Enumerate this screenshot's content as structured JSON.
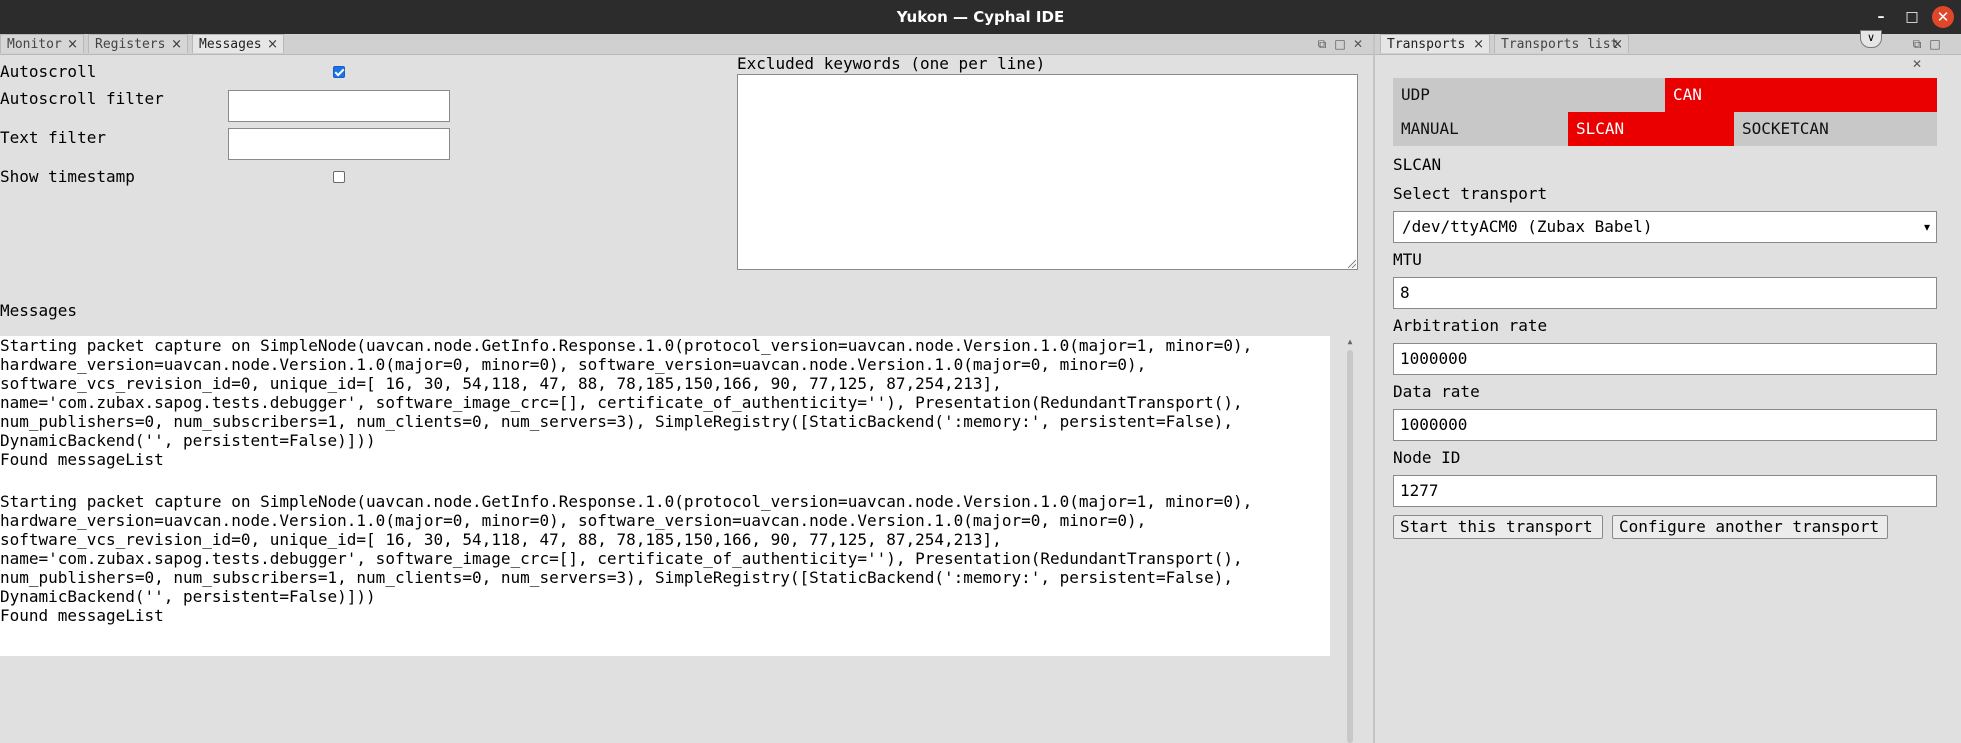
{
  "window": {
    "title": "Yukon — Cyphal IDE",
    "minimize": "–",
    "maximize": "□",
    "close": "✕"
  },
  "left_tabs": [
    {
      "label": "Monitor",
      "close": "×"
    },
    {
      "label": "Registers",
      "close": "×"
    },
    {
      "label": "Messages",
      "close": "×"
    }
  ],
  "right_tabs": [
    {
      "label": "Transports",
      "close": "×"
    },
    {
      "label": "Transports list",
      "close": "×"
    }
  ],
  "messages_panel": {
    "autoscroll_label": "Autoscroll",
    "autoscroll_checked": true,
    "autoscroll_filter_label": "Autoscroll filter",
    "autoscroll_filter_value": "",
    "text_filter_label": "Text filter",
    "text_filter_value": "",
    "show_timestamp_label": "Show timestamp",
    "show_timestamp_checked": false,
    "excluded_keywords_label": "Excluded keywords (one per line)",
    "excluded_keywords_value": "",
    "messages_label": "Messages",
    "log": [
      "Starting packet capture on SimpleNode(uavcan.node.GetInfo.Response.1.0(protocol_version=uavcan.node.Version.1.0(major=1, minor=0),\nhardware_version=uavcan.node.Version.1.0(major=0, minor=0), software_version=uavcan.node.Version.1.0(major=0, minor=0),\nsoftware_vcs_revision_id=0, unique_id=[ 16, 30, 54,118, 47, 88, 78,185,150,166, 90, 77,125, 87,254,213],\nname='com.zubax.sapog.tests.debugger', software_image_crc=[], certificate_of_authenticity=''), Presentation(RedundantTransport(),\nnum_publishers=0, num_subscribers=1, num_clients=0, num_servers=3), SimpleRegistry([StaticBackend(':memory:', persistent=False),\nDynamicBackend('', persistent=False)]))\nFound messageList",
      "Starting packet capture on SimpleNode(uavcan.node.GetInfo.Response.1.0(protocol_version=uavcan.node.Version.1.0(major=1, minor=0),\nhardware_version=uavcan.node.Version.1.0(major=0, minor=0), software_version=uavcan.node.Version.1.0(major=0, minor=0),\nsoftware_vcs_revision_id=0, unique_id=[ 16, 30, 54,118, 47, 88, 78,185,150,166, 90, 77,125, 87,254,213],\nname='com.zubax.sapog.tests.debugger', software_image_crc=[], certificate_of_authenticity=''), Presentation(RedundantTransport(),\nnum_publishers=0, num_subscribers=1, num_clients=0, num_servers=3), SimpleRegistry([StaticBackend(':memory:', persistent=False),\nDynamicBackend('', persistent=False)]))\nFound messageList"
    ]
  },
  "transports_panel": {
    "protocol_tabs": [
      {
        "label": "UDP",
        "active": false
      },
      {
        "label": "CAN",
        "active": true
      }
    ],
    "can_tabs": [
      {
        "label": "MANUAL",
        "active": false
      },
      {
        "label": "SLCAN",
        "active": true
      },
      {
        "label": "SOCKETCAN",
        "active": false
      }
    ],
    "section_title": "SLCAN",
    "select_transport_label": "Select transport",
    "select_transport_value": "/dev/ttyACM0 (Zubax Babel)",
    "mtu_label": "MTU",
    "mtu_value": "8",
    "arbitration_rate_label": "Arbitration rate",
    "arbitration_rate_value": "1000000",
    "data_rate_label": "Data rate",
    "data_rate_value": "1000000",
    "node_id_label": "Node ID",
    "node_id_value": "1277",
    "start_button": "Start this transport",
    "configure_button": "Configure another transport"
  },
  "colors": {
    "active_red": "#ea0000",
    "titlebar": "#2c2c2c",
    "background": "#e0e0e0"
  }
}
